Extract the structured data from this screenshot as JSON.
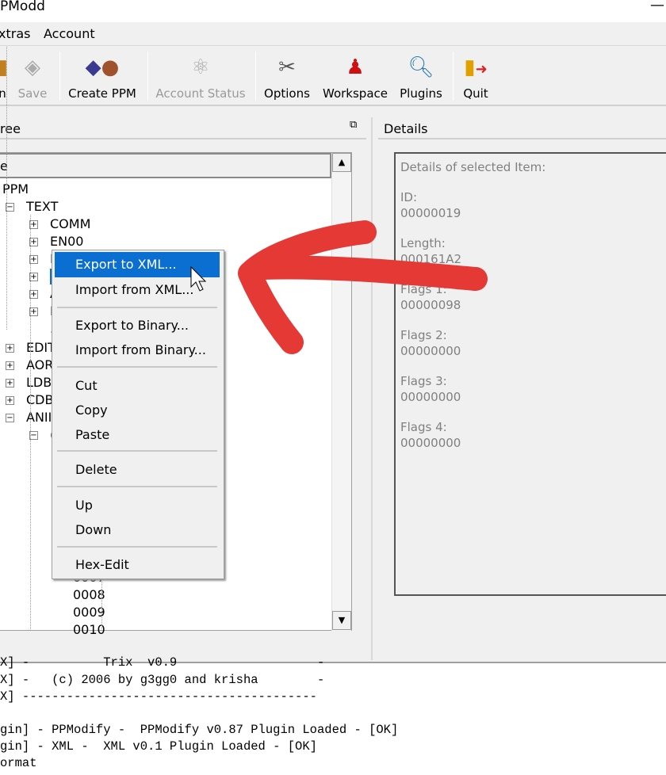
{
  "window": {
    "title": "PModd",
    "minimize": "—"
  },
  "menubar": [
    "xtras",
    "Account"
  ],
  "toolbar": [
    {
      "label": "n",
      "icon": "open-icon",
      "disabled": false
    },
    {
      "label": "Save",
      "icon": "save-icon",
      "disabled": true
    },
    {
      "label": "Create PPM",
      "icon": "create-ppm-icon",
      "disabled": false
    },
    {
      "label": "Account Status",
      "icon": "account-status-icon",
      "disabled": true
    },
    {
      "label": "Options",
      "icon": "tools-icon",
      "disabled": false
    },
    {
      "label": "Workspace",
      "icon": "person-icon",
      "disabled": false
    },
    {
      "label": "Plugins",
      "icon": "magnifier-icon",
      "disabled": false
    },
    {
      "label": "Quit",
      "icon": "exit-door-icon",
      "disabled": false
    }
  ],
  "tree_pane": {
    "title": "ree",
    "column": "e",
    "nodes": [
      {
        "label": "PPM"
      },
      {
        "label": "TEXT"
      },
      {
        "label": "COMM"
      },
      {
        "label": "EN00"
      },
      {
        "label": "I"
      },
      {
        "label": ""
      },
      {
        "label": "A"
      },
      {
        "label": "I"
      },
      {
        "label": "."
      },
      {
        "label": "EDIT"
      },
      {
        "label": "AOR"
      },
      {
        "label": "LDB"
      },
      {
        "label": "CDB"
      },
      {
        "label": "ANII"
      },
      {
        "label": "("
      },
      {
        "label": "0007"
      },
      {
        "label": "0008"
      },
      {
        "label": "0009"
      },
      {
        "label": "0010"
      }
    ]
  },
  "context_menu": [
    {
      "label": "Export to XML...",
      "highlighted": true
    },
    {
      "label": "Import from XML..."
    },
    {
      "label": "Export to Binary..."
    },
    {
      "label": "Import from Binary..."
    },
    {
      "label": "Cut"
    },
    {
      "label": "Copy"
    },
    {
      "label": "Paste"
    },
    {
      "label": "Delete"
    },
    {
      "label": "Up"
    },
    {
      "label": "Down"
    },
    {
      "label": "Hex-Edit"
    }
  ],
  "details_pane": {
    "title": "Details",
    "heading": "Details of selected Item:",
    "fields": [
      {
        "label": "ID:",
        "value": "00000019"
      },
      {
        "label": "Length:",
        "value": "000161A2"
      },
      {
        "label": "Flags 1:",
        "value": "00000098"
      },
      {
        "label": "Flags 2:",
        "value": "00000000"
      },
      {
        "label": "Flags 3:",
        "value": "00000000"
      },
      {
        "label": "Flags 4:",
        "value": "00000000"
      }
    ]
  },
  "log": [
    "X] -          Trix  v0.9                   -",
    "X] -   (c) 2006 by g3gg0 and krisha        -",
    "X] ----------------------------------------",
    "",
    "gin] - PPModify -  PPModify v0.87 Plugin Loaded - [OK]",
    "gin] - XML -  XML v0.1 Plugin Loaded - [OK]",
    "ormat"
  ],
  "colors": {
    "highlight": "#0a6fd1",
    "annotation_arrow": "#e53935"
  }
}
